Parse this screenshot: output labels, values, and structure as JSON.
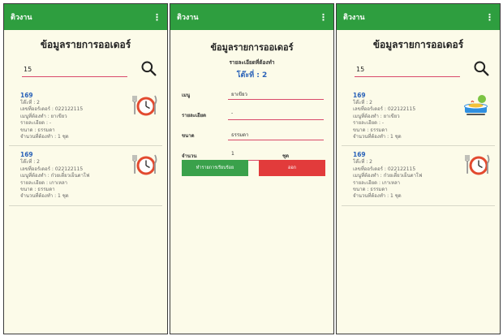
{
  "app": {
    "title": "ติวงาน",
    "menu_glyph": "⋮"
  },
  "screen1": {
    "title": "ข้อมูลรายการออเดอร์",
    "search": {
      "value": "15",
      "placeholder": ""
    },
    "orders": [
      {
        "id": "169",
        "table": "โต๊ะที่ : 2",
        "order_no": "เลขที่ออร์เดอร์ : 022122115",
        "menu": "เมนูที่ต้องทำ : ยาเขียว",
        "detail": "รายละเอียด : -",
        "size": "ขนาด : ธรรมดา",
        "qty": "จำนวนที่ต้องทำ : 1 ชุด",
        "icon": "clock-cutlery-icon"
      },
      {
        "id": "169",
        "table": "โต๊ะที่ : 2",
        "order_no": "เลขที่ออร์เดอร์ : 022122115",
        "menu": "เมนูที่ต้องทำ : ก๋วยเตี๋ยวเย็นตาโฟ",
        "detail": "รายละเอียด : เกาเหลา",
        "size": "ขนาด : ธรรมดา",
        "qty": "จำนวนที่ต้องทำ : 1 ชุด",
        "icon": "clock-cutlery-icon"
      }
    ]
  },
  "screen2": {
    "title": "ข้อมูลรายการออเดอร์",
    "subtitle": "รายละเอียดที่ต้องทำ",
    "table": "โต๊ะที่ : 2",
    "fields": {
      "menu_label": "เมนู",
      "menu_value": "ยาเขียว",
      "detail_label": "รายละเอียด",
      "detail_value": "-",
      "size_label": "ขนาด",
      "size_value": "ธรรมดา",
      "qty_label": "จำนวน",
      "qty_value": "1",
      "qty_unit": "ชุด"
    },
    "buttons": {
      "confirm": "ทำรายการเรียบร้อย",
      "cancel": "ออก"
    }
  },
  "screen3": {
    "title": "ข้อมูลรายการออเดอร์",
    "search": {
      "value": "15",
      "placeholder": ""
    },
    "orders": [
      {
        "id": "169",
        "table": "โต๊ะที่ : 2",
        "order_no": "เลขที่ออร์เดอร์ : 022122115",
        "menu": "เมนูที่ต้องทำ : ยาเขียว",
        "detail": "รายละเอียด : -",
        "size": "ขนาด : ธรรมดา",
        "qty": "จำนวนที่ต้องทำ : 1 ชุด",
        "icon": "food-done-icon"
      },
      {
        "id": "169",
        "table": "โต๊ะที่ : 2",
        "order_no": "เลขที่ออร์เดอร์ : 022122115",
        "menu": "เมนูที่ต้องทำ : ก๋วยเตี๋ยวเย็นตาโฟ",
        "detail": "รายละเอียด : เกาเหลา",
        "size": "ขนาด : ธรรมดา",
        "qty": "จำนวนที่ต้องทำ : 1 ชุด",
        "icon": "clock-cutlery-icon"
      }
    ]
  },
  "colors": {
    "appbar": "#2e9e3f",
    "accent_blue": "#2a62b8",
    "underline": "#d94a6a",
    "confirm": "#3aa14b",
    "cancel": "#e23b3b",
    "icon_red": "#e24a2f"
  }
}
